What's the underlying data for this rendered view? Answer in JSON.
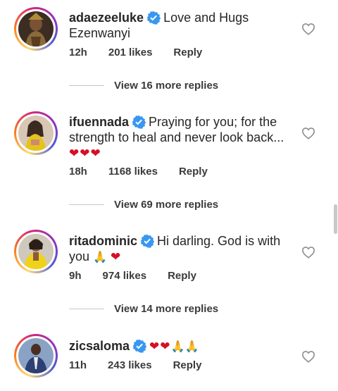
{
  "comments": [
    {
      "username": "adaezeeluke",
      "line1": "Love and Hugs",
      "line2": "Ezenwanyi",
      "time": "12h",
      "likes": "201 likes",
      "reply": "Reply",
      "more_replies": "View 16 more replies"
    },
    {
      "username": "ifuennada",
      "line1": "Praying for you; for the",
      "line2": "strength to heal and never look back...",
      "line3": "❤❤❤",
      "time": "18h",
      "likes": "1168 likes",
      "reply": "Reply",
      "more_replies": "View 69 more replies"
    },
    {
      "username": "ritadominic",
      "line1": "Hi darling. God is with",
      "line2_text": "you",
      "line2_pray": "🙏",
      "line2_heart": "❤",
      "time": "9h",
      "likes": "974 likes",
      "reply": "Reply",
      "more_replies": "View 14 more replies"
    },
    {
      "username": "zicsaloma",
      "hearts": "❤❤",
      "pray": "🙏🙏",
      "time": "11h",
      "likes": "243 likes",
      "reply": "Reply"
    }
  ],
  "icons": {
    "verified": "verified-badge-icon",
    "like": "heart-outline-icon"
  },
  "colors": {
    "verified": "#3897f0",
    "heart": "#d50f25",
    "text": "#262626",
    "meta": "#3a3a3a"
  }
}
